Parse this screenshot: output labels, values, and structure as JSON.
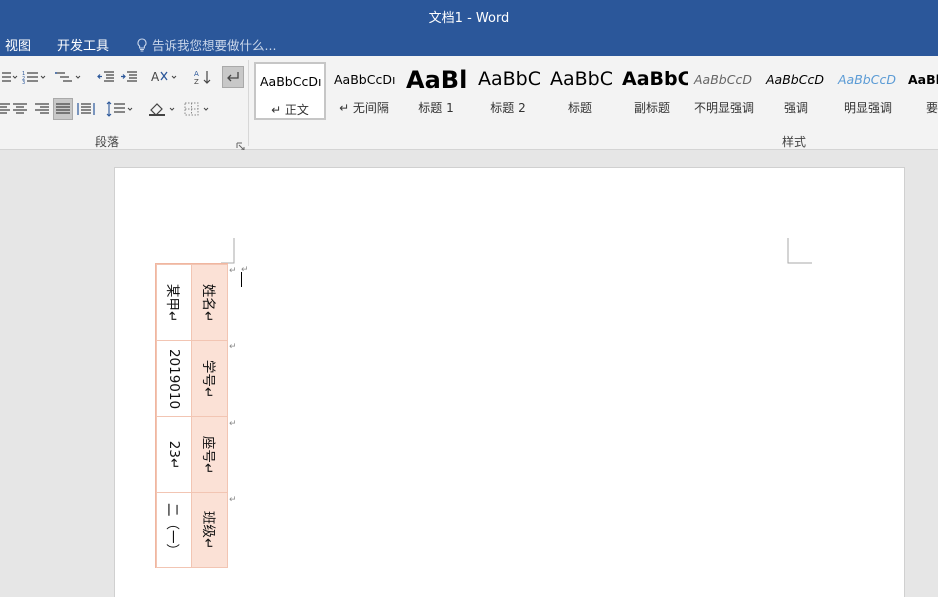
{
  "window": {
    "title": "文档1 - Word"
  },
  "tabs": [
    {
      "label": "视图"
    },
    {
      "label": "开发工具"
    }
  ],
  "tell_me": {
    "placeholder": "告诉我您想要做什么..."
  },
  "ribbon": {
    "paragraph_group": {
      "label": "段落"
    },
    "styles_group": {
      "label": "样式",
      "items": [
        {
          "sample": "AaBbCcDı",
          "name": "↵ 正文",
          "selected": true
        },
        {
          "sample": "AaBbCcDı",
          "name": "↵ 无间隔"
        },
        {
          "sample": "AaBl",
          "name": "标题 1"
        },
        {
          "sample": "AaBbC",
          "name": "标题 2"
        },
        {
          "sample": "AaBbC",
          "name": "标题"
        },
        {
          "sample": "AaBbC",
          "name": "副标题"
        },
        {
          "sample": "AaBbCcD",
          "name": "不明显强调"
        },
        {
          "sample": "AaBbCcD",
          "name": "强调"
        },
        {
          "sample": "AaBbCcD",
          "name": "明显强调"
        },
        {
          "sample": "AaBb",
          "name": "要"
        }
      ]
    }
  },
  "document": {
    "table": {
      "rows": [
        {
          "header": "姓名↵",
          "value": "某甲↵"
        },
        {
          "header": "学号↵",
          "value": "2019010"
        },
        {
          "header": "座号↵",
          "value": "23↵"
        },
        {
          "header": "班级↵",
          "value": "二（一）"
        }
      ]
    },
    "paragraph_mark": "↵"
  },
  "colors": {
    "title_bar": "#2b579a",
    "table_header_fill": "#fbe1d6",
    "table_border": "#f2c5b3"
  }
}
